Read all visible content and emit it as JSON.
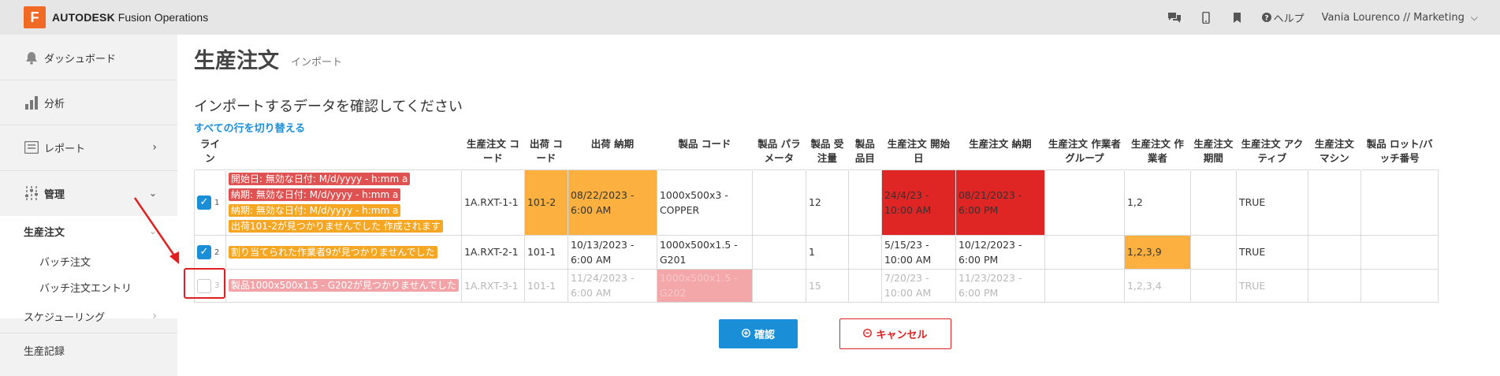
{
  "app": {
    "logo_letter": "F",
    "brand_bold": "AUTODESK",
    "brand_rest": " Fusion Operations"
  },
  "topbar": {
    "help_label": "ヘルプ",
    "user_label": "Vania Lourenco // Marketing"
  },
  "sidebar": {
    "items": [
      {
        "label": "ダッシュボード",
        "icon": "bell-icon"
      },
      {
        "label": "分析",
        "icon": "bar-chart-icon"
      },
      {
        "label": "レポート",
        "icon": "report-icon"
      },
      {
        "label": "管理",
        "icon": "sliders-icon"
      },
      {
        "label": "生産注文"
      },
      {
        "label": "スケジューリング"
      },
      {
        "label": "生産記録"
      }
    ],
    "subitems": [
      "バッチ注文",
      "バッチ注文エントリ"
    ]
  },
  "main": {
    "title": "生産注文",
    "subtitle": "インポート",
    "heading": "インポートするデータを確認してください",
    "toggle_all": "すべての行を切り替える",
    "columns": [
      "ライン",
      "",
      "生産注文 コード",
      "出荷 コード",
      "出荷 納期",
      "製品 コード",
      "製品 パラメータ",
      "製品 受注量",
      "製品 品目",
      "生産注文 開始日",
      "生産注文 納期",
      "生産注文 作業者グループ",
      "生産注文 作業者",
      "生産注文 期間",
      "生産注文 アクティブ",
      "生産注文 マシン",
      "製品 ロット/バッチ番号"
    ],
    "rows": [
      {
        "line": "1",
        "checked": true,
        "errors": [
          {
            "text": "開始日: 無効な日付: M/d/yyyy - h:mm a",
            "color": "red"
          },
          {
            "text": "納期: 無効な日付: M/d/yyyy - h:mm a",
            "color": "red"
          },
          {
            "text": "納期: 無効な日付: M/d/yyyy - h:mm a",
            "color": "orange"
          },
          {
            "text": "出荷101-2が見つかりませんでした 作成されます",
            "color": "orange"
          }
        ],
        "order_code": "1A.RXT-1-1",
        "shipment_code": "101-2",
        "shipment_due": "08/22/2023 - 6:00 AM",
        "product_code": "1000x500x3 - COPPER",
        "product_params": "",
        "qty": "12",
        "item": "",
        "start": "24/4/23 - 10:00 AM",
        "due": "08/21/2023 - 6:00 PM",
        "worker_group": "",
        "worker": "1,2",
        "duration": "",
        "active": "TRUE",
        "machine": "",
        "lot": ""
      },
      {
        "line": "2",
        "checked": true,
        "errors": [
          {
            "text": "割り当てられた作業者9が見つかりませんでした",
            "color": "orange"
          }
        ],
        "order_code": "1A.RXT-2-1",
        "shipment_code": "101-1",
        "shipment_due": "10/13/2023 - 6:00 AM",
        "product_code": "1000x500x1.5 - G201",
        "product_params": "",
        "qty": "1",
        "item": "",
        "start": "5/15/23 - 10:00 AM",
        "due": "10/12/2023 - 6:00 PM",
        "worker_group": "",
        "worker": "1,2,3,9",
        "duration": "",
        "active": "TRUE",
        "machine": "",
        "lot": ""
      },
      {
        "line": "3",
        "checked": false,
        "errors": [
          {
            "text": "製品1000x500x1.5 - G202が見つかりませんでした",
            "color": "pink"
          }
        ],
        "order_code": "1A.RXT-3-1",
        "shipment_code": "101-1",
        "shipment_due": "11/24/2023 - 6:00 AM",
        "product_code": "1000x500x1.5 - G202",
        "product_params": "",
        "qty": "15",
        "item": "",
        "start": "7/20/23 - 10:00 AM",
        "due": "11/23/2023 - 6:00 PM",
        "worker_group": "",
        "worker": "1,2,3,4",
        "duration": "",
        "active": "TRUE",
        "machine": "",
        "lot": ""
      }
    ],
    "confirm_label": "確認",
    "cancel_label": "キャンセル"
  },
  "colors": {
    "accent": "#1a8fd8",
    "error_red": "#e02525",
    "warning_orange": "#fbb040",
    "brand_orange": "#f06a25"
  }
}
